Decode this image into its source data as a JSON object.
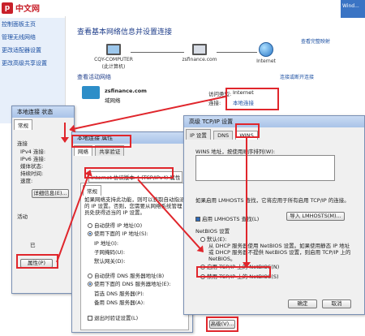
{
  "watermark": {
    "logo": "php",
    "site_cn": "中文网",
    "url": ""
  },
  "left_nav": {
    "items": [
      "控制面板主页",
      "管理无线网络",
      "更改适配器设置",
      "更改高级共享设置"
    ]
  },
  "top_right": "Wind...",
  "network_center": {
    "title": "查看基本网络信息并设置连接",
    "full_map_link": "查看完整映射",
    "nodes": [
      {
        "name": "CQY-COMPUTER",
        "sub": "(此计算机)"
      },
      {
        "name": "zsfinance.com",
        "sub": ""
      },
      {
        "name": "Internet",
        "sub": ""
      }
    ],
    "active_label": "查看活动网络",
    "connect_link": "连接或断开连接",
    "network_name": "zsfinance.com",
    "network_type": "域网络",
    "access_type_label": "访问类型:",
    "access_type_value": "Internet",
    "connection_label": "连接:",
    "connection_value": "本地连接"
  },
  "status_win": {
    "title": "本地连接 状态",
    "tab": "常规",
    "section_connect": "连接",
    "rows": [
      "IPv4 连接:",
      "IPv6 连接:",
      "媒体状态:",
      "持续时间:",
      "速度:"
    ],
    "detail_btn": "详细信息(E)...",
    "activity": "活动",
    "sent": "已",
    "props_btn": "属性(P)"
  },
  "props_win": {
    "title": "本地连接 属性",
    "tabs": [
      "网络",
      "共享验证"
    ],
    "item": "Internet 协议版本 4 (TCP/IPv4) 属性",
    "inner_tab": "常规",
    "desc": "如果网络支持此功能，则可以获取自动指派的 IP 设置。否则，您需要从网络系统管理员处获得适当的 IP 设置。",
    "auto_ip": "自动获得 IP 地址(O)",
    "manual_ip": "使用下面的 IP 地址(S):",
    "ip_addr": "IP 地址(I):",
    "subnet": "子网掩码(U):",
    "gateway": "默认网关(D):",
    "auto_dns": "自动获得 DNS 服务器地址(B)",
    "manual_dns": "使用下面的 DNS 服务器地址(E):",
    "pref_dns": "首选 DNS 服务器(P):",
    "alt_dns": "备用 DNS 服务器(A):",
    "validate": "退出时验证设置(L)",
    "adv_btn": "高级(V)..."
  },
  "adv_win": {
    "title": "高级 TCP/IP 设置",
    "tabs": [
      "IP 设置",
      "DNS",
      "WINS"
    ],
    "wins_label": "WINS 地址，按使用顺序排列(W):",
    "desc": "如果启用 LMHOSTS 查找，它将应用于所有启用 TCP/IP 的连接。",
    "lmhosts": "启用 LMHOSTS 查找(L)",
    "import_btn": "导入 LMHOSTS(M)...",
    "netbios_label": "NetBIOS 设置",
    "default": "默认(E):",
    "default_desc": "从 DHCP 服务器使用 NetBIOS 设置。如果使用静态 IP 地址或 DHCP 服务器不提供 NetBIOS 设置，则启用 TCP/IP 上的 NetBIOS。",
    "enable_nb": "启用 TCP/IP 上的 NetBIOS(N)",
    "disable_nb": "禁用 TCP/IP 上的 NetBIOS(S)",
    "ok_btn": "确定",
    "cancel_btn": "取消"
  },
  "advanced_btn_bottom": "高级(V)..."
}
